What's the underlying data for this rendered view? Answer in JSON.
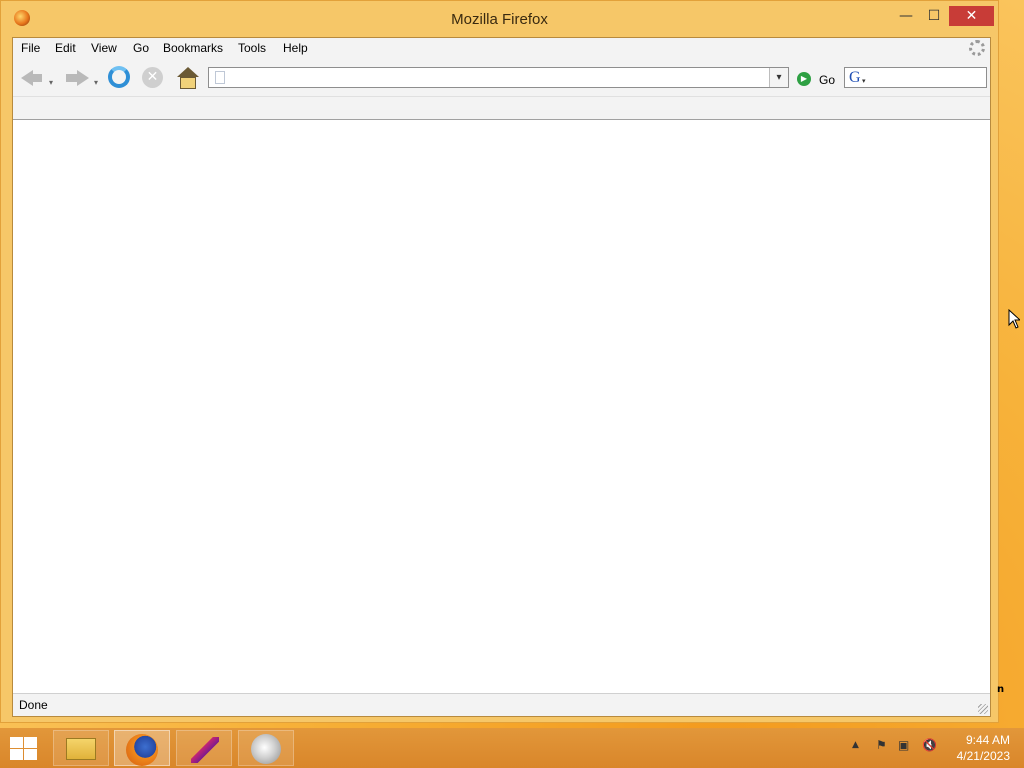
{
  "window": {
    "title": "Mozilla Firefox",
    "controls": {
      "minimize": "—",
      "maximize": "☐",
      "close": "✕"
    }
  },
  "menubar": {
    "items": [
      "File",
      "Edit",
      "View",
      "Go",
      "Bookmarks",
      "Tools",
      "Help"
    ]
  },
  "navbar": {
    "url_value": "",
    "go_label": "Go",
    "search_engine_letter": "G",
    "search_value": "",
    "stop_glyph": "✕",
    "url_dropdown_glyph": "▾",
    "history_dropdown_glyph": "▾"
  },
  "statusbar": {
    "text": "Done"
  },
  "taskbar": {
    "items": [
      {
        "name": "file-explorer",
        "icon": "folder-icon"
      },
      {
        "name": "firefox",
        "icon": "firefox-icon",
        "active": true
      },
      {
        "name": "feather-app",
        "icon": "feather-icon"
      },
      {
        "name": "gray-app",
        "icon": "gray-circle-icon"
      }
    ],
    "tray": {
      "arrow": "▲",
      "time": "9:44 AM",
      "date": "4/21/2023"
    }
  },
  "stray_text": "n",
  "colors": {
    "window_frame": "#f6c768",
    "taskbar": "#d9862a",
    "close_button": "#c83c37"
  }
}
